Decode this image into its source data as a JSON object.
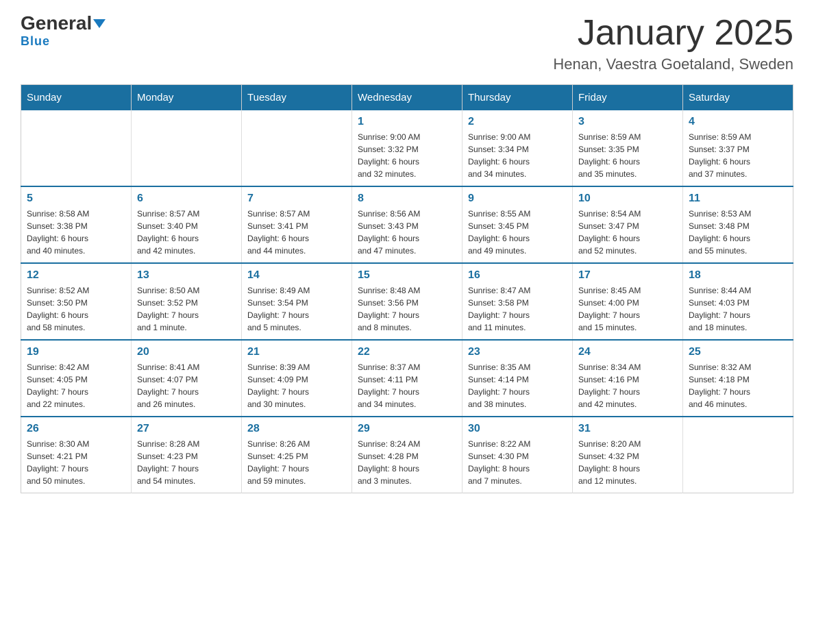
{
  "header": {
    "logo_general": "General",
    "logo_blue": "Blue",
    "title": "January 2025",
    "subtitle": "Henan, Vaestra Goetaland, Sweden"
  },
  "days_of_week": [
    "Sunday",
    "Monday",
    "Tuesday",
    "Wednesday",
    "Thursday",
    "Friday",
    "Saturday"
  ],
  "weeks": [
    [
      {
        "day": "",
        "info": ""
      },
      {
        "day": "",
        "info": ""
      },
      {
        "day": "",
        "info": ""
      },
      {
        "day": "1",
        "info": "Sunrise: 9:00 AM\nSunset: 3:32 PM\nDaylight: 6 hours\nand 32 minutes."
      },
      {
        "day": "2",
        "info": "Sunrise: 9:00 AM\nSunset: 3:34 PM\nDaylight: 6 hours\nand 34 minutes."
      },
      {
        "day": "3",
        "info": "Sunrise: 8:59 AM\nSunset: 3:35 PM\nDaylight: 6 hours\nand 35 minutes."
      },
      {
        "day": "4",
        "info": "Sunrise: 8:59 AM\nSunset: 3:37 PM\nDaylight: 6 hours\nand 37 minutes."
      }
    ],
    [
      {
        "day": "5",
        "info": "Sunrise: 8:58 AM\nSunset: 3:38 PM\nDaylight: 6 hours\nand 40 minutes."
      },
      {
        "day": "6",
        "info": "Sunrise: 8:57 AM\nSunset: 3:40 PM\nDaylight: 6 hours\nand 42 minutes."
      },
      {
        "day": "7",
        "info": "Sunrise: 8:57 AM\nSunset: 3:41 PM\nDaylight: 6 hours\nand 44 minutes."
      },
      {
        "day": "8",
        "info": "Sunrise: 8:56 AM\nSunset: 3:43 PM\nDaylight: 6 hours\nand 47 minutes."
      },
      {
        "day": "9",
        "info": "Sunrise: 8:55 AM\nSunset: 3:45 PM\nDaylight: 6 hours\nand 49 minutes."
      },
      {
        "day": "10",
        "info": "Sunrise: 8:54 AM\nSunset: 3:47 PM\nDaylight: 6 hours\nand 52 minutes."
      },
      {
        "day": "11",
        "info": "Sunrise: 8:53 AM\nSunset: 3:48 PM\nDaylight: 6 hours\nand 55 minutes."
      }
    ],
    [
      {
        "day": "12",
        "info": "Sunrise: 8:52 AM\nSunset: 3:50 PM\nDaylight: 6 hours\nand 58 minutes."
      },
      {
        "day": "13",
        "info": "Sunrise: 8:50 AM\nSunset: 3:52 PM\nDaylight: 7 hours\nand 1 minute."
      },
      {
        "day": "14",
        "info": "Sunrise: 8:49 AM\nSunset: 3:54 PM\nDaylight: 7 hours\nand 5 minutes."
      },
      {
        "day": "15",
        "info": "Sunrise: 8:48 AM\nSunset: 3:56 PM\nDaylight: 7 hours\nand 8 minutes."
      },
      {
        "day": "16",
        "info": "Sunrise: 8:47 AM\nSunset: 3:58 PM\nDaylight: 7 hours\nand 11 minutes."
      },
      {
        "day": "17",
        "info": "Sunrise: 8:45 AM\nSunset: 4:00 PM\nDaylight: 7 hours\nand 15 minutes."
      },
      {
        "day": "18",
        "info": "Sunrise: 8:44 AM\nSunset: 4:03 PM\nDaylight: 7 hours\nand 18 minutes."
      }
    ],
    [
      {
        "day": "19",
        "info": "Sunrise: 8:42 AM\nSunset: 4:05 PM\nDaylight: 7 hours\nand 22 minutes."
      },
      {
        "day": "20",
        "info": "Sunrise: 8:41 AM\nSunset: 4:07 PM\nDaylight: 7 hours\nand 26 minutes."
      },
      {
        "day": "21",
        "info": "Sunrise: 8:39 AM\nSunset: 4:09 PM\nDaylight: 7 hours\nand 30 minutes."
      },
      {
        "day": "22",
        "info": "Sunrise: 8:37 AM\nSunset: 4:11 PM\nDaylight: 7 hours\nand 34 minutes."
      },
      {
        "day": "23",
        "info": "Sunrise: 8:35 AM\nSunset: 4:14 PM\nDaylight: 7 hours\nand 38 minutes."
      },
      {
        "day": "24",
        "info": "Sunrise: 8:34 AM\nSunset: 4:16 PM\nDaylight: 7 hours\nand 42 minutes."
      },
      {
        "day": "25",
        "info": "Sunrise: 8:32 AM\nSunset: 4:18 PM\nDaylight: 7 hours\nand 46 minutes."
      }
    ],
    [
      {
        "day": "26",
        "info": "Sunrise: 8:30 AM\nSunset: 4:21 PM\nDaylight: 7 hours\nand 50 minutes."
      },
      {
        "day": "27",
        "info": "Sunrise: 8:28 AM\nSunset: 4:23 PM\nDaylight: 7 hours\nand 54 minutes."
      },
      {
        "day": "28",
        "info": "Sunrise: 8:26 AM\nSunset: 4:25 PM\nDaylight: 7 hours\nand 59 minutes."
      },
      {
        "day": "29",
        "info": "Sunrise: 8:24 AM\nSunset: 4:28 PM\nDaylight: 8 hours\nand 3 minutes."
      },
      {
        "day": "30",
        "info": "Sunrise: 8:22 AM\nSunset: 4:30 PM\nDaylight: 8 hours\nand 7 minutes."
      },
      {
        "day": "31",
        "info": "Sunrise: 8:20 AM\nSunset: 4:32 PM\nDaylight: 8 hours\nand 12 minutes."
      },
      {
        "day": "",
        "info": ""
      }
    ]
  ]
}
